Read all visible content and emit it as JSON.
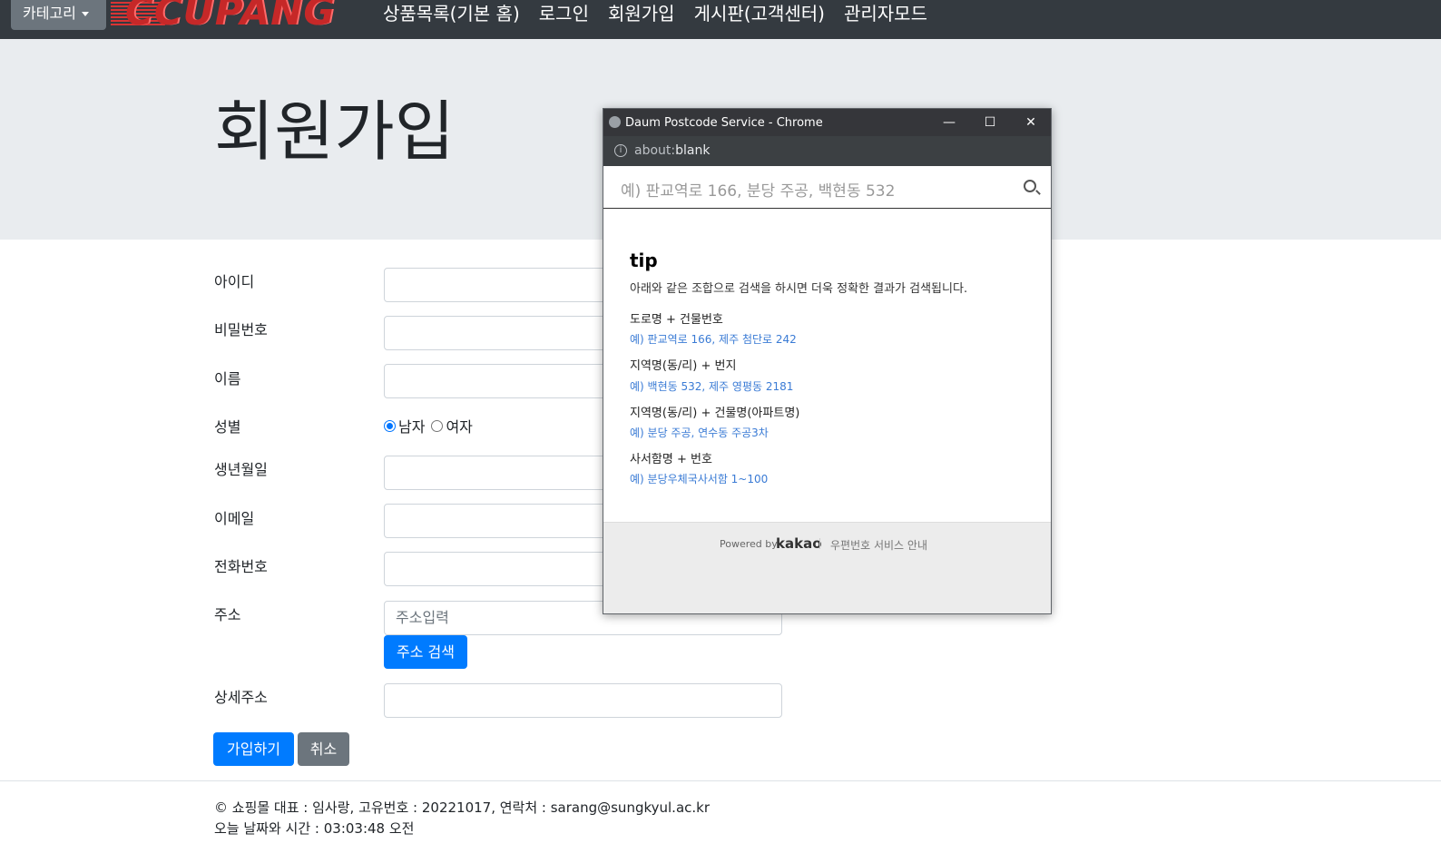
{
  "navbar": {
    "category_label": "카테고리",
    "logo_text": "CCUPANG",
    "links": [
      "상품목록(기본 홈)",
      "로그인",
      "회원가입",
      "게시판(고객센터)",
      "관리자모드"
    ]
  },
  "jumbotron": {
    "title": "회원가입"
  },
  "form": {
    "id_label": "아이디",
    "password_label": "비밀번호",
    "name_label": "이름",
    "gender_label": "성별",
    "gender_male": "남자",
    "gender_female": "여자",
    "birth_label": "생년월일",
    "email_label": "이메일",
    "phone_label": "전화번호",
    "address_label": "주소",
    "address_placeholder": "주소입력",
    "address_search_button": "주소 검색",
    "detail_address_label": "상세주소",
    "submit_button": "가입하기",
    "cancel_button": "취소"
  },
  "footer": {
    "line1": "© 쇼핑몰 대표 : 임사랑, 고유번호 : 20221017, 연락처 : sarang@sungkyul.ac.kr",
    "line2": "오늘 날짜와 시간 : 03:03:48 오전"
  },
  "popup": {
    "window_title": "Daum Postcode Service - Chrome",
    "url_dim": "about:",
    "url_main": "blank",
    "search_placeholder": "예) 판교역로 166, 분당 주공, 백현동 532",
    "tip_title": "tip",
    "tip_desc": "아래와 같은 조합으로 검색을 하시면 더욱 정확한 결과가 검색됩니다.",
    "tips": [
      {
        "heading": "도로명 + 건물번호",
        "example": "예) 판교역로 166,  제주 첨단로 242"
      },
      {
        "heading": "지역명(동/리) + 번지",
        "example": "예) 백현동 532,  제주 영평동 2181"
      },
      {
        "heading": "지역명(동/리) + 건물명(아파트명)",
        "example": "예) 분당 주공,  연수동 주공3차"
      },
      {
        "heading": "사서함명 + 번호",
        "example": "예) 분당우체국사서함 1~100"
      }
    ],
    "powered_by": "Powered by",
    "kakao": "kakao",
    "service_guide": "우편번호 서비스 안내"
  },
  "colors": {
    "navbar": "#343a40",
    "primary": "#007bff",
    "secondary": "#6c757d",
    "jumbotron": "#e9ecef"
  }
}
